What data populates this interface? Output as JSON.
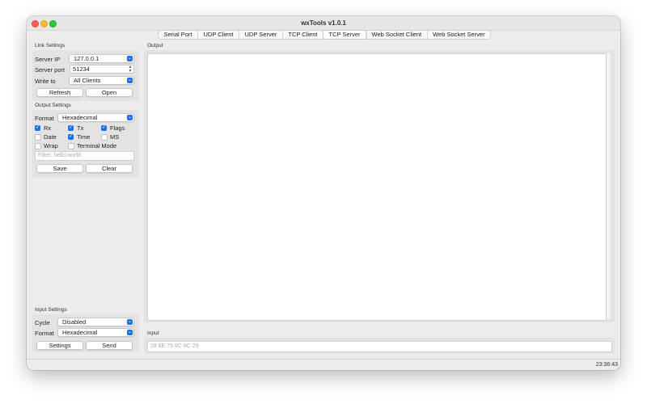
{
  "window": {
    "title": "wxTools v1.0.1"
  },
  "tabs": [
    {
      "label": "Serial Port"
    },
    {
      "label": "UDP Client"
    },
    {
      "label": "UDP Server"
    },
    {
      "label": "TCP Client"
    },
    {
      "label": "TCP Server",
      "active": true
    },
    {
      "label": "Web Socket Client"
    },
    {
      "label": "Web Socket Server"
    }
  ],
  "link_settings": {
    "title": "Link Settings",
    "server_ip_label": "Server IP",
    "server_ip_value": "127.0.0.1",
    "server_port_label": "Server port",
    "server_port_value": "51234",
    "write_to_label": "Write to",
    "write_to_value": "All Clients",
    "refresh_label": "Refresh",
    "open_label": "Open"
  },
  "output_settings": {
    "title": "Output Settings",
    "format_label": "Format",
    "format_value": "Hexadecimal",
    "checkboxes": [
      {
        "label": "Rx",
        "checked": true
      },
      {
        "label": "Tx",
        "checked": true
      },
      {
        "label": "Flags",
        "checked": true
      },
      {
        "label": "Date",
        "checked": false
      },
      {
        "label": "Time",
        "checked": true
      },
      {
        "label": "MS",
        "checked": false
      },
      {
        "label": "Wrap",
        "checked": false
      },
      {
        "label": "Terminal Mode",
        "checked": false
      }
    ],
    "filter_placeholder": "Filter: hello;world",
    "save_label": "Save",
    "clear_label": "Clear"
  },
  "input_settings": {
    "title": "Input Settings",
    "cycle_label": "Cycle",
    "cycle_value": "Disabled",
    "format_label": "Format",
    "format_value": "Hexadecimal",
    "settings_label": "Settings",
    "send_label": "Send"
  },
  "output": {
    "title": "Output",
    "content": ""
  },
  "input": {
    "title": "Input",
    "placeholder": "28 6E 75 6C 6C 29"
  },
  "status": {
    "time": "23:36:43"
  },
  "colors": {
    "accent": "#1c6ef2",
    "window_bg": "#ececec"
  }
}
